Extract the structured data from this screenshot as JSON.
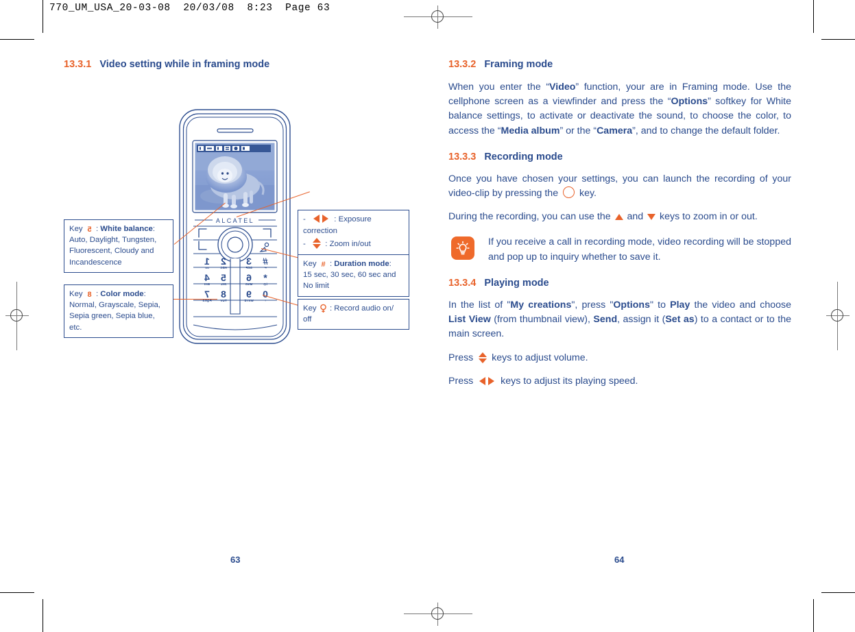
{
  "print_header": "770_UM_USA_20-03-08  20/03/08  8:23  Page 63",
  "left_page": {
    "page_number": "63",
    "section": {
      "number": "13.3.1",
      "title": "Video setting while in framing mode"
    },
    "callouts": [
      {
        "id": "white-balance",
        "icon": "key-5-icon",
        "lines": [
          {
            "prefix": "Key ",
            "icon": true,
            "label": "White balance",
            "after": ":"
          },
          {
            "text": "Auto, Daylight, Tungsten,"
          },
          {
            "text": "Fluorescent, Cloudy and"
          },
          {
            "text": "Incandescence"
          }
        ]
      },
      {
        "id": "color-mode",
        "icon": "key-8-icon",
        "lines": [
          {
            "prefix": "Key ",
            "icon": true,
            "label": "Color mode",
            "after": ":"
          },
          {
            "text": "Normal, Grayscale, Sepia,"
          },
          {
            "text": "Sepia green, Sepia blue, etc."
          }
        ]
      },
      {
        "id": "exposure-zoom",
        "lines": [
          {
            "text": "-  ◀▶ : Exposure correction"
          },
          {
            "text": "-  ↕ : Zoom in/out"
          }
        ]
      },
      {
        "id": "duration-mode",
        "icon": "key-hash-icon",
        "lines": [
          {
            "prefix": "Key ",
            "icon": true,
            "label": "Duration mode",
            "after": ":"
          },
          {
            "text": "15 sec, 30 sec, 60 sec and"
          },
          {
            "text": "No limit"
          }
        ]
      },
      {
        "id": "record-audio",
        "icon": "key-0-icon",
        "lines": [
          {
            "prefix": "Key ",
            "icon": true,
            "label": "",
            "after": ": Record audio on/"
          },
          {
            "text": "off"
          }
        ]
      }
    ],
    "phone": {
      "brand": "ALCATEL",
      "screen_image": "lion-photo",
      "status_icons": [
        "battery-icon",
        "signal-icon",
        "alarm-icon",
        "message-icon",
        "mode-icon",
        "info-icon"
      ],
      "keypad": [
        {
          "digit": "1",
          "letters": "∞"
        },
        {
          "digit": "2",
          "letters": "ABC"
        },
        {
          "digit": "3",
          "letters": "DEF"
        },
        {
          "digit": "#",
          "letters": "↵"
        },
        {
          "digit": "4",
          "letters": "GHI"
        },
        {
          "digit": "5",
          "letters": "JKL"
        },
        {
          "digit": "6",
          "letters": "MNO"
        },
        {
          "digit": "*",
          "letters": "/@"
        },
        {
          "digit": "7",
          "letters": "PQRS"
        },
        {
          "digit": "8",
          "letters": "TUV"
        },
        {
          "digit": "9",
          "letters": "WXYZ"
        },
        {
          "digit": "0",
          "letters": "+"
        }
      ]
    }
  },
  "right_page": {
    "page_number": "64",
    "sections": [
      {
        "number": "13.3.2",
        "title": "Framing mode",
        "paragraphs": [
          "When you enter the “Video” function, your are in Framing mode. Use the cellphone screen as a viewfinder and press the “Options” softkey for White balance settings, to activate or deactivate the sound, to choose the color, to access the “Media album” or the “Camera”, and to change the default folder."
        ]
      },
      {
        "number": "13.3.3",
        "title": "Recording mode",
        "paragraphs": [
          "Once you have chosen your settings, you can launch the recording of your video-clip by pressing the   key.",
          "During the recording, you can use the   and   keys to zoom in or out."
        ]
      },
      {
        "number": "13.3.4",
        "title": "Playing mode",
        "paragraphs": [
          "In the list of \"My creations\", press \"Options\" to Play the video and choose List View (from thumbnail view), Send, assign it (Set as) to a contact or to the main screen.",
          "Press   keys to adjust volume.",
          "Press   keys to adjust its playing speed."
        ]
      }
    ],
    "note": {
      "icon": "lightbulb-icon",
      "text": "If you receive a call in recording mode, video recording will be stopped and pop up to inquiry whether to save it."
    }
  },
  "colors": {
    "accent_orange": "#e8622a",
    "body_blue": "#2a4b8d",
    "note_badge": "#ef6a2b"
  }
}
